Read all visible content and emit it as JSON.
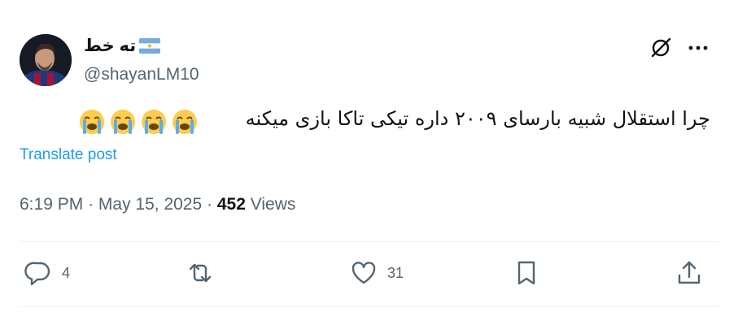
{
  "author": {
    "display_name": "ته خط",
    "handle": "@shayanLM10"
  },
  "tweet": {
    "text": "چرا استقلال شبیه بارسای ۲۰۰۹ داره تیکی تاکا بازی میکنه",
    "emoji": [
      "loudly-crying-face",
      "loudly-crying-face",
      "loudly-crying-face",
      "loudly-crying-face"
    ],
    "translate_label": "Translate post",
    "time": "6:19 PM",
    "date": "May 15, 2025",
    "views_count": "452",
    "views_label": "Views",
    "separator": "·"
  },
  "actions": {
    "replies": "4",
    "retweets": "",
    "likes": "31"
  },
  "icons": {
    "grok": "grok-icon",
    "more": "more-icon",
    "reply": "reply-icon",
    "retweet": "retweet-icon",
    "like": "heart-icon",
    "bookmark": "bookmark-icon",
    "share": "share-icon"
  },
  "colors": {
    "link": "#1d9bf0",
    "secondary": "#536471",
    "text": "#0f1419",
    "divider": "#eff3f4"
  }
}
